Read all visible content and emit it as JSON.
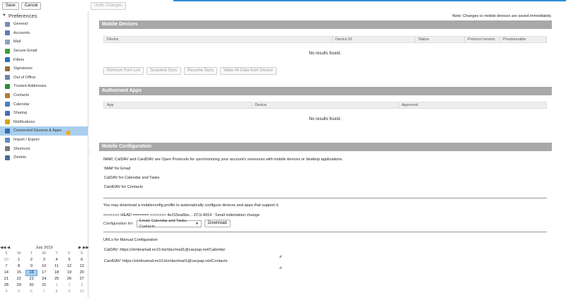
{
  "toolbar": {
    "save": "Save",
    "cancel": "Cancel",
    "undo": "Undo Changes"
  },
  "sidebar": {
    "header": "Preferences",
    "items": [
      {
        "label": "General",
        "icon": "gear-icon",
        "color": "#7a8fa8"
      },
      {
        "label": "Accounts",
        "icon": "accounts-icon",
        "color": "#5b7fb5"
      },
      {
        "label": "Mail",
        "icon": "mail-icon",
        "color": "#8aa2c2"
      },
      {
        "label": "Secure Email",
        "icon": "secure-email-icon",
        "color": "#3d9c3d"
      },
      {
        "label": "Filters",
        "icon": "filter-icon",
        "color": "#2f6fb8"
      },
      {
        "label": "Signatures",
        "icon": "signature-icon",
        "color": "#9a6a3a"
      },
      {
        "label": "Out of Office",
        "icon": "out-of-office-icon",
        "color": "#6e87a8"
      },
      {
        "label": "Trusted Addresses",
        "icon": "shield-icon",
        "color": "#2e8b3a"
      },
      {
        "label": "Contacts",
        "icon": "contacts-icon",
        "color": "#b07a3a"
      },
      {
        "label": "Calendar",
        "icon": "calendar-icon",
        "color": "#4a7dc4"
      },
      {
        "label": "Sharing",
        "icon": "sharing-icon",
        "color": "#4a6fb0"
      },
      {
        "label": "Notifications",
        "icon": "bell-icon",
        "color": "#d8a21a"
      },
      {
        "label": "Connected Devices & Apps",
        "icon": "devices-icon",
        "color": "#2f6fb8"
      },
      {
        "label": "Import / Export",
        "icon": "import-export-icon",
        "color": "#5a8ac2"
      },
      {
        "label": "Shortcuts",
        "icon": "keyboard-icon",
        "color": "#7a7a7a"
      },
      {
        "label": "Zimlets",
        "icon": "zimlet-icon",
        "color": "#4a6a9a"
      }
    ]
  },
  "calendar": {
    "month": "July 2019",
    "nav": {
      "prev_year": "◀◀",
      "prev": "◀",
      "next": "▶",
      "next_year": "▶▶"
    },
    "day_names": [
      "S",
      "M",
      "T",
      "W",
      "T",
      "F",
      "S"
    ],
    "days": [
      [
        "30",
        "1",
        "2",
        "3",
        "4",
        "5",
        "6"
      ],
      [
        "7",
        "8",
        "9",
        "10",
        "11",
        "12",
        "13"
      ],
      [
        "14",
        "15",
        "16",
        "17",
        "18",
        "19",
        "20"
      ],
      [
        "21",
        "22",
        "23",
        "24",
        "25",
        "26",
        "27"
      ],
      [
        "28",
        "29",
        "30",
        "31",
        "1",
        "2",
        "3"
      ],
      [
        "4",
        "5",
        "6",
        "7",
        "8",
        "9",
        "10"
      ]
    ],
    "today": "16"
  },
  "note": "Note: Changes to mobile devices are saved immediately.",
  "mobile_devices": {
    "title": "Mobile Devices",
    "columns": [
      "Device",
      "Device ID",
      "Status",
      "Protocol version",
      "Provisionable"
    ],
    "empty": "No results found.",
    "actions": [
      "Remove from List",
      "Suspend Sync",
      "Resume Sync",
      "Wipe All Data from Device"
    ]
  },
  "authorised_apps": {
    "title": "Authorised Apps",
    "columns": [
      "App",
      "Device",
      "Approved"
    ],
    "empty": "No results found."
  },
  "mobile_config": {
    "title": "Mobile Configuration",
    "intro": "IMAP, CalDAV and CardDAV are Open Protocols for synchronizing your account's resources with mobile devices or desktop applications.",
    "bullets": [
      "IMAP for Email",
      "CalDAV for Calendar and Tasks",
      "CardDAV for Contacts"
    ],
    "download_text": "You may download a mobileconfig profile to automatically configure devices and apps that support it.",
    "merge_line": "<<<<<<< HEAD ======= >>>>>>> 4e315ea6be... ZCS-4919 : Small Indentation change",
    "config_label": "Configuration for:",
    "config_value": "Email, Calendar and Tasks, Contacts",
    "download_button": "Download",
    "urls_title": "URLs for Manual Configuration",
    "caldav": "CalDAV: https://zimbramail.ex10.biz/dav/mail1@cacpap.net/Calendar",
    "carddav": "CardDAV: https://zimbramail.ex10.biz/dav/mail1@cacpap.net/Contacts"
  }
}
